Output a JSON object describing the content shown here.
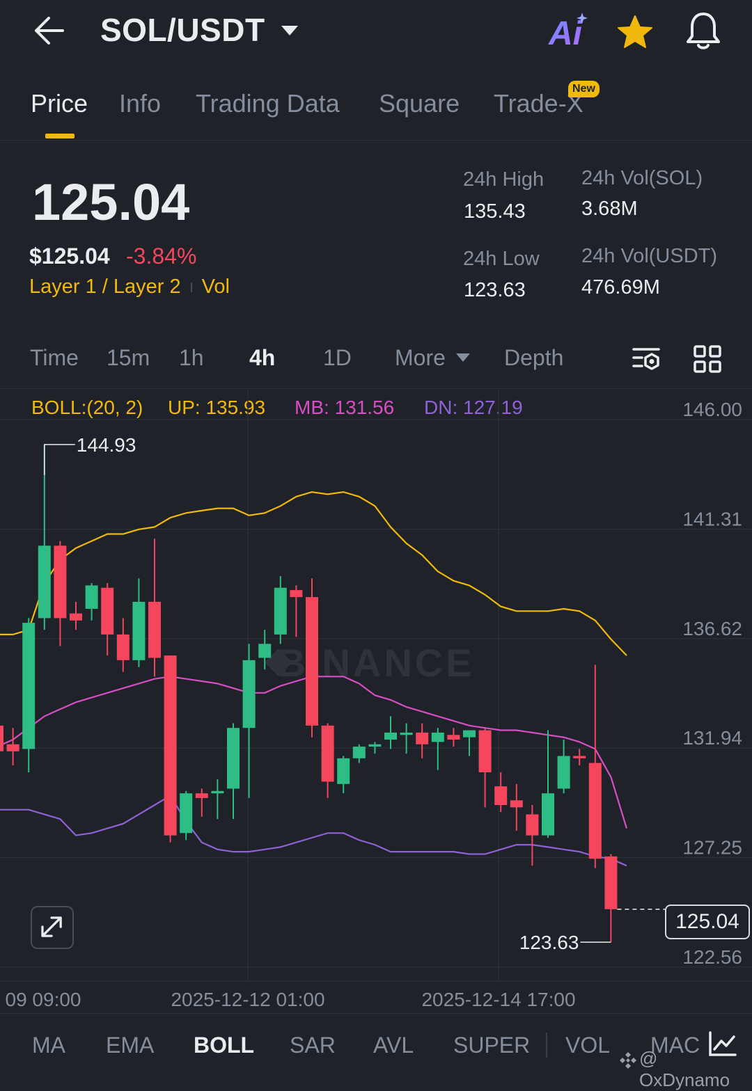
{
  "header": {
    "pair": "SOL/USDT",
    "ai_label": "Ai"
  },
  "tabs": [
    {
      "label": "Price",
      "active": true
    },
    {
      "label": "Info"
    },
    {
      "label": "Trading Data"
    },
    {
      "label": "Square"
    },
    {
      "label": "Trade-X",
      "badge": "New"
    }
  ],
  "ticker": {
    "last_price": "125.04",
    "usd_price": "$125.04",
    "change_pct": "-3.84%",
    "tag_primary": "Layer 1 / Layer 2",
    "tag_secondary": "Vol",
    "high_label": "24h High",
    "high_value": "135.43",
    "low_label": "24h Low",
    "low_value": "123.63",
    "vol_base_label": "24h Vol(SOL)",
    "vol_base_value": "3.68M",
    "vol_quote_label": "24h Vol(USDT)",
    "vol_quote_value": "476.69M"
  },
  "timeframes": [
    {
      "label": "Time"
    },
    {
      "label": "15m"
    },
    {
      "label": "1h"
    },
    {
      "label": "4h",
      "active": true
    },
    {
      "label": "1D"
    },
    {
      "label": "More"
    },
    {
      "label": "Depth"
    }
  ],
  "indicator": {
    "name": "BOLL:(20, 2)",
    "up": "UP: 135.93",
    "mb": "MB: 131.56",
    "dn": "DN: 127.19",
    "colors": {
      "up": "#f0b90b",
      "mb": "#d84fc4",
      "dn": "#8e62d6",
      "name": "#f0b90b"
    }
  },
  "chart_data": {
    "type": "candlestick",
    "watermark": "BINANCE",
    "y_ticks": [
      "146.00",
      "141.31",
      "136.62",
      "131.94",
      "127.25",
      "122.56"
    ],
    "ylim": [
      122.56,
      146.0
    ],
    "x_ticks": [
      "09 09:00",
      "2025-12-12 01:00",
      "2025-12-14 17:00"
    ],
    "high_marker": "144.93",
    "low_marker": "123.63",
    "current_price": "125.04",
    "up_color": "#2ebd85",
    "down_color": "#f6465d",
    "candles": [
      {
        "o": 132.9,
        "h": 133.4,
        "c": 131.8,
        "l": 131.2
      },
      {
        "o": 132.1,
        "h": 132.8,
        "c": 131.8,
        "l": 131.2
      },
      {
        "o": 131.9,
        "h": 137.5,
        "c": 137.3,
        "l": 130.9
      },
      {
        "o": 137.5,
        "h": 144.9,
        "c": 140.6,
        "l": 137.0
      },
      {
        "o": 140.6,
        "h": 140.8,
        "c": 137.5,
        "l": 136.3
      },
      {
        "o": 137.7,
        "h": 138.2,
        "c": 137.4,
        "l": 137.0
      },
      {
        "o": 137.9,
        "h": 139.0,
        "c": 138.9,
        "l": 137.4
      },
      {
        "o": 138.8,
        "h": 139.0,
        "c": 136.8,
        "l": 135.9
      },
      {
        "o": 136.8,
        "h": 137.5,
        "c": 135.7,
        "l": 135.2
      },
      {
        "o": 135.7,
        "h": 139.2,
        "c": 138.2,
        "l": 135.4
      },
      {
        "o": 138.2,
        "h": 140.9,
        "c": 135.8,
        "l": 135.0
      },
      {
        "o": 135.9,
        "h": 135.9,
        "c": 128.2,
        "l": 127.9
      },
      {
        "o": 128.3,
        "h": 130.1,
        "c": 130.0,
        "l": 128.0
      },
      {
        "o": 130.0,
        "h": 130.2,
        "c": 129.8,
        "l": 129.0
      },
      {
        "o": 130.0,
        "h": 130.6,
        "c": 130.1,
        "l": 128.9
      },
      {
        "o": 130.2,
        "h": 133.0,
        "c": 132.8,
        "l": 128.9
      },
      {
        "o": 132.8,
        "h": 136.4,
        "c": 135.7,
        "l": 129.8
      },
      {
        "o": 135.8,
        "h": 137.0,
        "c": 136.4,
        "l": 135.3
      },
      {
        "o": 136.8,
        "h": 139.3,
        "c": 138.8,
        "l": 136.4
      },
      {
        "o": 138.7,
        "h": 138.9,
        "c": 138.4,
        "l": 136.7
      },
      {
        "o": 138.4,
        "h": 139.2,
        "c": 132.9,
        "l": 132.4
      },
      {
        "o": 132.9,
        "h": 133.0,
        "c": 130.5,
        "l": 129.8
      },
      {
        "o": 130.4,
        "h": 131.6,
        "c": 131.5,
        "l": 130.0
      },
      {
        "o": 131.5,
        "h": 132.1,
        "c": 132.0,
        "l": 131.3
      },
      {
        "o": 132.0,
        "h": 132.2,
        "c": 132.1,
        "l": 131.7
      },
      {
        "o": 132.3,
        "h": 133.3,
        "c": 132.6,
        "l": 131.9
      },
      {
        "o": 132.5,
        "h": 133.0,
        "c": 132.6,
        "l": 131.7
      },
      {
        "o": 132.6,
        "h": 133.0,
        "c": 132.1,
        "l": 131.5
      },
      {
        "o": 132.2,
        "h": 132.8,
        "c": 132.6,
        "l": 131.0
      },
      {
        "o": 132.5,
        "h": 132.8,
        "c": 132.3,
        "l": 132.0
      },
      {
        "o": 132.4,
        "h": 132.7,
        "c": 132.7,
        "l": 131.6
      },
      {
        "o": 132.7,
        "h": 132.8,
        "c": 130.9,
        "l": 129.4
      },
      {
        "o": 130.3,
        "h": 130.9,
        "c": 129.5,
        "l": 129.2
      },
      {
        "o": 129.7,
        "h": 130.4,
        "c": 129.4,
        "l": 128.4
      },
      {
        "o": 129.1,
        "h": 129.5,
        "c": 128.2,
        "l": 126.9
      },
      {
        "o": 128.2,
        "h": 132.7,
        "c": 130.0,
        "l": 128.1
      },
      {
        "o": 130.2,
        "h": 132.3,
        "c": 131.6,
        "l": 130.0
      },
      {
        "o": 131.6,
        "h": 131.9,
        "c": 131.5,
        "l": 131.2
      },
      {
        "o": 131.3,
        "h": 135.5,
        "c": 127.2,
        "l": 126.8
      },
      {
        "o": 127.3,
        "h": 127.4,
        "c": 125.04,
        "l": 123.63
      }
    ],
    "series": [
      {
        "name": "UP",
        "values": [
          136.8,
          136.8,
          137.0,
          139.0,
          140.0,
          140.5,
          140.8,
          141.1,
          141.1,
          141.3,
          141.4,
          141.8,
          142.0,
          142.1,
          142.2,
          142.2,
          141.9,
          142.0,
          142.3,
          142.7,
          142.9,
          142.8,
          142.9,
          142.7,
          142.3,
          141.4,
          140.7,
          140.2,
          139.5,
          139.1,
          138.9,
          138.5,
          138.0,
          137.8,
          137.8,
          137.8,
          137.9,
          137.8,
          137.4,
          136.6,
          135.9
        ]
      },
      {
        "name": "MB",
        "values": [
          132.0,
          132.3,
          132.8,
          133.3,
          133.6,
          133.9,
          134.1,
          134.3,
          134.5,
          134.7,
          134.9,
          135.0,
          134.9,
          134.8,
          134.7,
          134.5,
          134.3,
          134.3,
          134.6,
          134.8,
          135.0,
          135.0,
          135.0,
          134.7,
          134.2,
          134.0,
          133.7,
          133.5,
          133.3,
          133.1,
          132.9,
          132.8,
          132.7,
          132.7,
          132.6,
          132.5,
          132.4,
          132.2,
          131.9,
          130.7,
          128.5
        ]
      },
      {
        "name": "DN",
        "values": [
          129.3,
          129.3,
          129.3,
          129.1,
          128.9,
          128.2,
          128.3,
          128.5,
          128.7,
          129.1,
          129.5,
          129.9,
          128.8,
          127.9,
          127.6,
          127.5,
          127.5,
          127.6,
          127.7,
          127.9,
          128.1,
          128.3,
          128.3,
          128.0,
          127.8,
          127.5,
          127.5,
          127.5,
          127.5,
          127.5,
          127.4,
          127.4,
          127.6,
          127.8,
          127.8,
          127.7,
          127.6,
          127.5,
          127.3,
          127.2,
          126.9
        ]
      }
    ]
  },
  "bottom_indicators": [
    {
      "label": "MA"
    },
    {
      "label": "EMA"
    },
    {
      "label": "BOLL",
      "active": true
    },
    {
      "label": "SAR"
    },
    {
      "label": "AVL"
    },
    {
      "label": "SUPER"
    },
    {
      "label": "VOL"
    },
    {
      "label": "MAC"
    }
  ],
  "watermark_user": "@ OxDynamo"
}
